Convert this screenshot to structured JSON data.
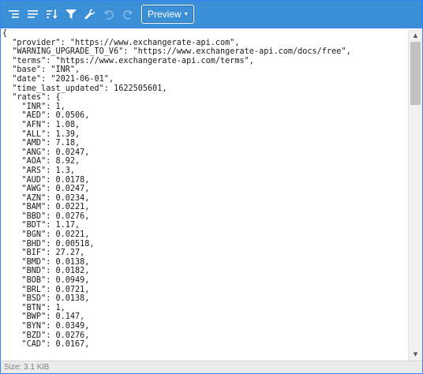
{
  "toolbar": {
    "buttons": [
      {
        "name": "format-icon",
        "enabled": true
      },
      {
        "name": "compact-icon",
        "enabled": true
      },
      {
        "name": "sort-icon",
        "enabled": true
      },
      {
        "name": "filter-icon",
        "enabled": true
      },
      {
        "name": "repair-icon",
        "enabled": true
      },
      {
        "name": "undo-icon",
        "enabled": false
      },
      {
        "name": "redo-icon",
        "enabled": false
      }
    ],
    "mode_label": "Preview",
    "mode_caret": "▾"
  },
  "code_lines": [
    "{",
    "  \"provider\": \"https://www.exchangerate-api.com\",",
    "  \"WARNING_UPGRADE_TO_V6\": \"https://www.exchangerate-api.com/docs/free\",",
    "  \"terms\": \"https://www.exchangerate-api.com/terms\",",
    "  \"base\": \"INR\",",
    "  \"date\": \"2021-06-01\",",
    "  \"time_last_updated\": 1622505601,",
    "  \"rates\": {",
    "    \"INR\": 1,",
    "    \"AED\": 0.0506,",
    "    \"AFN\": 1.08,",
    "    \"ALL\": 1.39,",
    "    \"AMD\": 7.18,",
    "    \"ANG\": 0.0247,",
    "    \"AOA\": 8.92,",
    "    \"ARS\": 1.3,",
    "    \"AUD\": 0.0178,",
    "    \"AWG\": 0.0247,",
    "    \"AZN\": 0.0234,",
    "    \"BAM\": 0.0221,",
    "    \"BBD\": 0.0276,",
    "    \"BDT\": 1.17,",
    "    \"BGN\": 0.0221,",
    "    \"BHD\": 0.00518,",
    "    \"BIF\": 27.27,",
    "    \"BMD\": 0.0138,",
    "    \"BND\": 0.0182,",
    "    \"BOB\": 0.0949,",
    "    \"BRL\": 0.0721,",
    "    \"BSD\": 0.0138,",
    "    \"BTN\": 1,",
    "    \"BWP\": 0.147,",
    "    \"BYN\": 0.0349,",
    "    \"BZD\": 0.0276,",
    "    \"CAD\": 0.0167,"
  ],
  "scrollbar": {
    "up": "▲",
    "down": "▼"
  },
  "status": {
    "size": "Size: 3.1 KiB"
  }
}
